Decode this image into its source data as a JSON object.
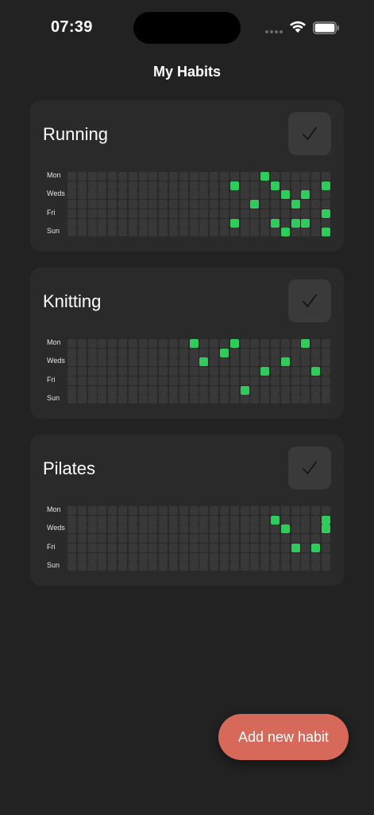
{
  "status": {
    "time": "07:39"
  },
  "header": {
    "title": "My Habits"
  },
  "day_labels": [
    "Mon",
    "Weds",
    "Fri",
    "Sun"
  ],
  "grid_columns": 26,
  "grid_rows": 7,
  "habits": [
    {
      "name": "Running",
      "check_label": "✓",
      "completed_cells": [
        [
          19,
          0
        ],
        [
          16,
          1
        ],
        [
          20,
          1
        ],
        [
          25,
          1
        ],
        [
          26,
          1
        ],
        [
          21,
          2
        ],
        [
          23,
          2
        ],
        [
          18,
          3
        ],
        [
          22,
          3
        ],
        [
          25,
          4
        ],
        [
          16,
          5
        ],
        [
          20,
          5
        ],
        [
          22,
          5
        ],
        [
          23,
          5
        ],
        [
          21,
          6
        ],
        [
          25,
          6
        ]
      ]
    },
    {
      "name": "Knitting",
      "check_label": "✓",
      "completed_cells": [
        [
          12,
          0
        ],
        [
          16,
          0
        ],
        [
          23,
          0
        ],
        [
          15,
          1
        ],
        [
          13,
          2
        ],
        [
          21,
          2
        ],
        [
          19,
          3
        ],
        [
          24,
          3
        ],
        [
          17,
          5
        ]
      ]
    },
    {
      "name": "Pilates",
      "check_label": "✓",
      "completed_cells": [
        [
          20,
          1
        ],
        [
          25,
          1
        ],
        [
          21,
          2
        ],
        [
          25,
          2
        ],
        [
          22,
          4
        ],
        [
          24,
          4
        ]
      ]
    }
  ],
  "actions": {
    "add_label": "Add new habit"
  },
  "colors": {
    "background": "#222222",
    "card": "#2a2a2a",
    "cell_empty": "#383838",
    "cell_done": "#2ecc5a",
    "accent": "#d6695a"
  }
}
